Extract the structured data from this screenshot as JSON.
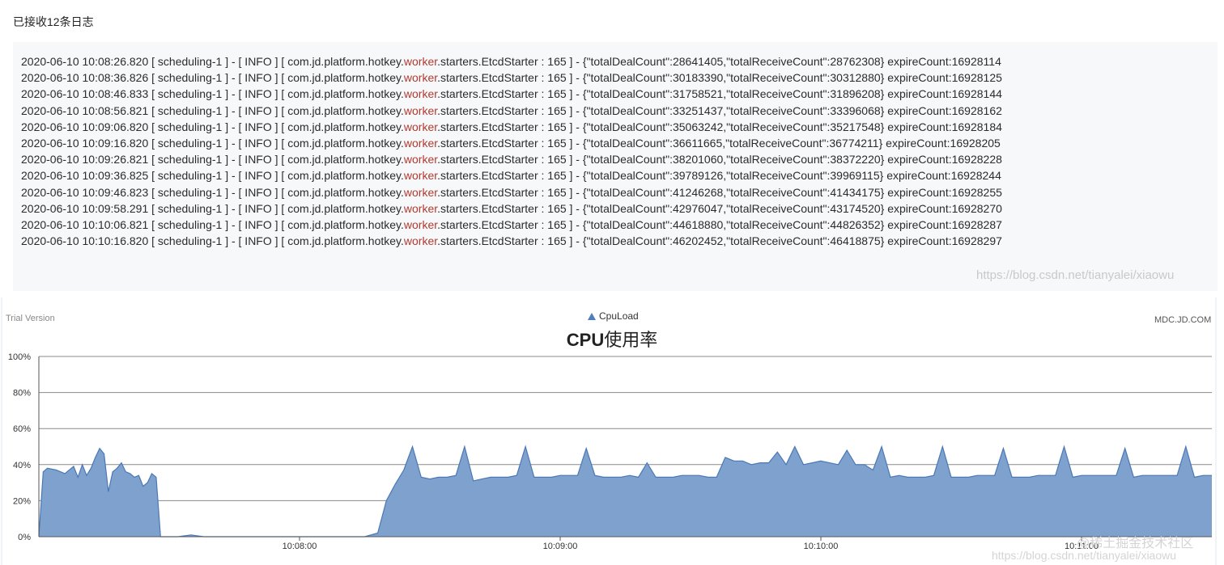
{
  "header": {
    "received_count": "已接收12条日志"
  },
  "log": {
    "keyword": "worker",
    "lines": [
      {
        "prefix": "2020-06-10 10:08:26.820 [ scheduling-1 ] - [ INFO ] [ com.jd.platform.hotkey.",
        "suffix": ".starters.EtcdStarter : 165 ] - {\"totalDealCount\":28641405,\"totalReceiveCount\":28762308} expireCount:16928114"
      },
      {
        "prefix": "2020-06-10 10:08:36.826 [ scheduling-1 ] - [ INFO ] [ com.jd.platform.hotkey.",
        "suffix": ".starters.EtcdStarter : 165 ] - {\"totalDealCount\":30183390,\"totalReceiveCount\":30312880} expireCount:16928125"
      },
      {
        "prefix": "2020-06-10 10:08:46.833 [ scheduling-1 ] - [ INFO ] [ com.jd.platform.hotkey.",
        "suffix": ".starters.EtcdStarter : 165 ] - {\"totalDealCount\":31758521,\"totalReceiveCount\":31896208} expireCount:16928144"
      },
      {
        "prefix": "2020-06-10 10:08:56.821 [ scheduling-1 ] - [ INFO ] [ com.jd.platform.hotkey.",
        "suffix": ".starters.EtcdStarter : 165 ] - {\"totalDealCount\":33251437,\"totalReceiveCount\":33396068} expireCount:16928162"
      },
      {
        "prefix": "2020-06-10 10:09:06.820 [ scheduling-1 ] - [ INFO ] [ com.jd.platform.hotkey.",
        "suffix": ".starters.EtcdStarter : 165 ] - {\"totalDealCount\":35063242,\"totalReceiveCount\":35217548} expireCount:16928184"
      },
      {
        "prefix": "2020-06-10 10:09:16.820 [ scheduling-1 ] - [ INFO ] [ com.jd.platform.hotkey.",
        "suffix": ".starters.EtcdStarter : 165 ] - {\"totalDealCount\":36611665,\"totalReceiveCount\":36774211} expireCount:16928205"
      },
      {
        "prefix": "2020-06-10 10:09:26.821 [ scheduling-1 ] - [ INFO ] [ com.jd.platform.hotkey.",
        "suffix": ".starters.EtcdStarter : 165 ] - {\"totalDealCount\":38201060,\"totalReceiveCount\":38372220} expireCount:16928228"
      },
      {
        "prefix": "2020-06-10 10:09:36.825 [ scheduling-1 ] - [ INFO ] [ com.jd.platform.hotkey.",
        "suffix": ".starters.EtcdStarter : 165 ] - {\"totalDealCount\":39789126,\"totalReceiveCount\":39969115} expireCount:16928244"
      },
      {
        "prefix": "2020-06-10 10:09:46.823 [ scheduling-1 ] - [ INFO ] [ com.jd.platform.hotkey.",
        "suffix": ".starters.EtcdStarter : 165 ] - {\"totalDealCount\":41246268,\"totalReceiveCount\":41434175} expireCount:16928255"
      },
      {
        "prefix": "2020-06-10 10:09:58.291 [ scheduling-1 ] - [ INFO ] [ com.jd.platform.hotkey.",
        "suffix": ".starters.EtcdStarter : 165 ] - {\"totalDealCount\":42976047,\"totalReceiveCount\":43174520} expireCount:16928270"
      },
      {
        "prefix": "2020-06-10 10:10:06.821 [ scheduling-1 ] - [ INFO ] [ com.jd.platform.hotkey.",
        "suffix": ".starters.EtcdStarter : 165 ] - {\"totalDealCount\":44618880,\"totalReceiveCount\":44826352} expireCount:16928287"
      },
      {
        "prefix": "2020-06-10 10:10:16.820 [ scheduling-1 ] - [ INFO ] [ com.jd.platform.hotkey.",
        "suffix": ".starters.EtcdStarter : 165 ] - {\"totalDealCount\":46202452,\"totalReceiveCount\":46418875} expireCount:16928297"
      }
    ],
    "watermark": "https://blog.csdn.net/tianyalei/xiaowu"
  },
  "chart_meta": {
    "trial_text": "Trial Version",
    "legend_label": "CpuLoad",
    "title_bold": "CPU",
    "title_rest": "使用率",
    "vendor_text": "MDC.JD.COM",
    "watermark_top": "@稀土掘金技术社区",
    "watermark_bottom": "https://blog.csdn.net/tianyalei/xiaowu",
    "fill_color": "#7ea1ce",
    "line_color": "#4a78b6"
  },
  "chart_data": {
    "type": "area",
    "title": "CPU使用率",
    "series": [
      {
        "name": "CpuLoad"
      }
    ],
    "ylim": [
      0,
      100
    ],
    "y_ticks": [
      "0%",
      "20%",
      "40%",
      "60%",
      "80%",
      "100%"
    ],
    "x_ticks": [
      "10:08:00",
      "10:09:00",
      "10:10:00",
      "10:11:00"
    ],
    "x_tick_seconds": [
      60,
      120,
      180,
      240
    ],
    "xlim_seconds": [
      0,
      270
    ],
    "x_seconds": [
      0,
      1,
      2,
      4,
      6,
      8,
      9,
      10,
      11,
      12,
      13,
      14,
      15,
      16,
      17,
      18,
      19,
      20,
      21,
      22,
      23,
      24,
      25,
      26,
      27,
      28,
      29,
      30,
      30.5,
      31,
      32,
      35,
      38,
      40,
      42,
      44,
      46,
      50,
      55,
      60,
      65,
      70,
      75,
      78,
      80,
      82,
      84,
      86,
      88,
      90,
      92,
      94,
      96,
      98,
      100,
      102,
      104,
      106,
      108,
      110,
      112,
      114,
      116,
      118,
      120,
      122,
      124,
      126,
      128,
      130,
      132,
      134,
      136,
      138,
      140,
      142,
      144,
      146,
      148,
      150,
      152,
      154,
      156,
      158,
      160,
      162,
      164,
      166,
      168,
      170,
      172,
      174,
      176,
      178,
      180,
      182,
      184,
      186,
      188,
      190,
      192,
      194,
      196,
      198,
      200,
      202,
      204,
      206,
      208,
      210,
      212,
      214,
      216,
      218,
      220,
      222,
      224,
      226,
      228,
      230,
      232,
      234,
      236,
      238,
      240,
      242,
      244,
      246,
      248,
      250,
      252,
      254,
      256,
      258,
      260,
      262,
      264,
      266,
      268,
      270
    ],
    "values": [
      0,
      36,
      38,
      37,
      35,
      39,
      33,
      40,
      34,
      38,
      44,
      49,
      46,
      25,
      36,
      38,
      41,
      36,
      35,
      33,
      34,
      28,
      30,
      35,
      33,
      0,
      0,
      0,
      0,
      0,
      0,
      1,
      0,
      0,
      0,
      0,
      0,
      0,
      0,
      0,
      0,
      0,
      0,
      2,
      20,
      29,
      37,
      50,
      33,
      32,
      33,
      33,
      34,
      50,
      31,
      32,
      33,
      33,
      33,
      34,
      50,
      33,
      33,
      33,
      34,
      34,
      34,
      49,
      34,
      33,
      33,
      33,
      34,
      33,
      41,
      33,
      33,
      33,
      34,
      34,
      34,
      33,
      33,
      44,
      42,
      42,
      40,
      41,
      41,
      47,
      40,
      50,
      40,
      41,
      42,
      41,
      40,
      48,
      40,
      40,
      37,
      50,
      33,
      34,
      33,
      33,
      33,
      34,
      50,
      33,
      33,
      33,
      34,
      34,
      34,
      49,
      33,
      33,
      33,
      34,
      34,
      34,
      50,
      33,
      34,
      34,
      34,
      34,
      34,
      49,
      33,
      34,
      34,
      34,
      34,
      34,
      50,
      33,
      34,
      34
    ]
  }
}
